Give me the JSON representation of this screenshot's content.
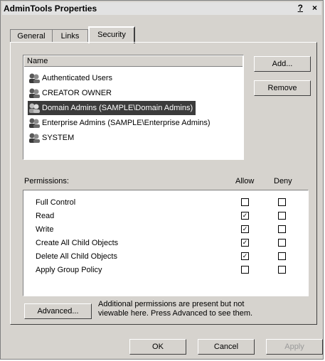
{
  "window": {
    "title": "AdminTools Properties",
    "help": "?",
    "close": "×"
  },
  "tabs": [
    {
      "label": "General"
    },
    {
      "label": "Links"
    },
    {
      "label": "Security"
    }
  ],
  "users": {
    "column": "Name",
    "items": [
      {
        "label": "Authenticated Users"
      },
      {
        "label": "CREATOR OWNER"
      },
      {
        "label": "Domain Admins (SAMPLE\\Domain Admins)"
      },
      {
        "label": "Enterprise Admins (SAMPLE\\Enterprise Admins)"
      },
      {
        "label": "SYSTEM"
      }
    ]
  },
  "buttons": {
    "add": "Add...",
    "remove": "Remove",
    "advanced": "Advanced...",
    "ok": "OK",
    "cancel": "Cancel",
    "apply": "Apply"
  },
  "permissions": {
    "label": "Permissions:",
    "allow": "Allow",
    "deny": "Deny",
    "rows": [
      {
        "label": "Full Control"
      },
      {
        "label": "Read"
      },
      {
        "label": "Write"
      },
      {
        "label": "Create All Child Objects"
      },
      {
        "label": "Delete All Child Objects"
      },
      {
        "label": "Apply Group Policy"
      }
    ]
  },
  "advanced_note": "Additional permissions are present but not viewable here. Press Advanced to see them."
}
